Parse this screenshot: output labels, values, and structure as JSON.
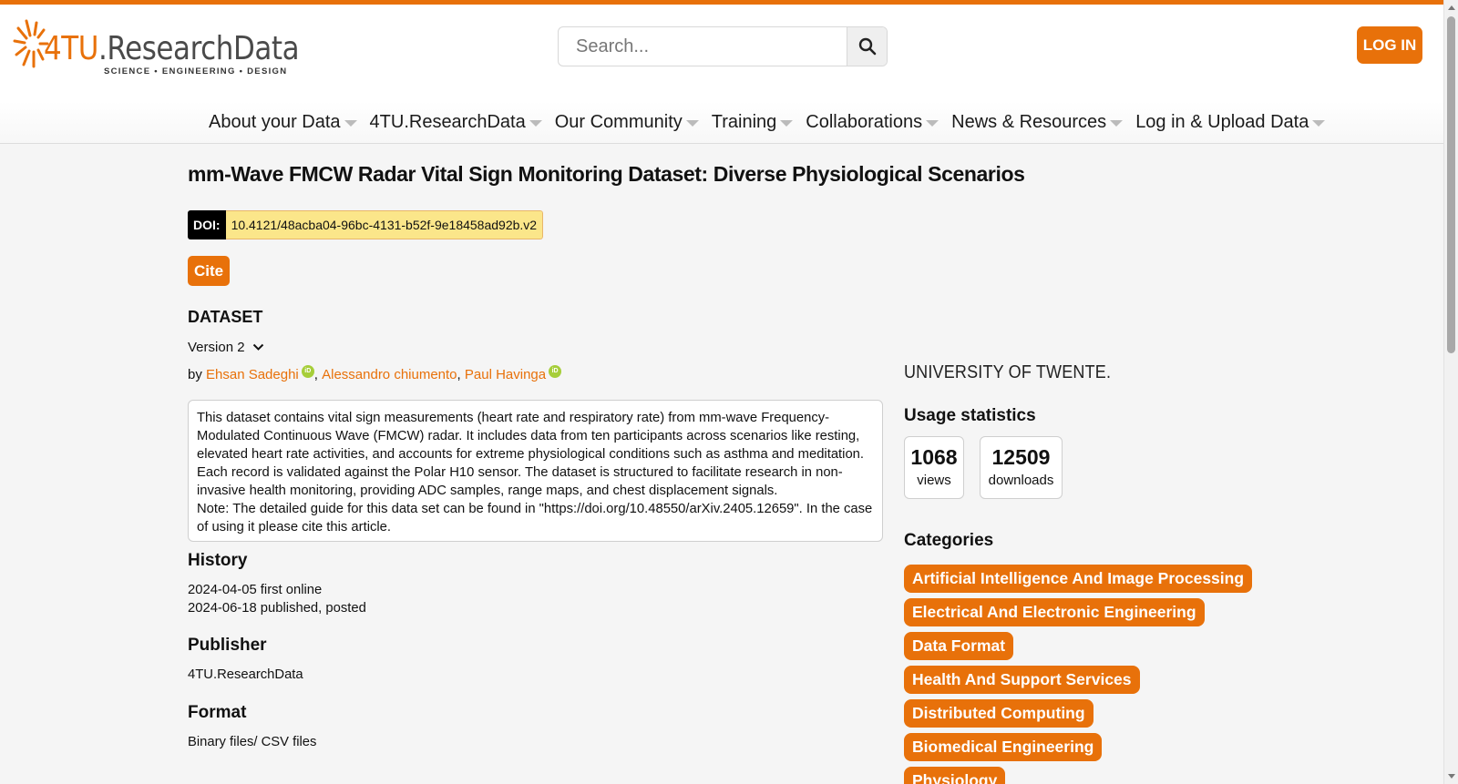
{
  "header": {
    "logo": {
      "brand": "4TU",
      "brand_rest": ".ResearchData",
      "tagline": "SCIENCE • ENGINEERING • DESIGN"
    },
    "search": {
      "placeholder": "Search...",
      "icon": "search-icon"
    },
    "login_label": "LOG IN"
  },
  "nav": {
    "items": [
      {
        "label": "About your Data"
      },
      {
        "label": "4TU.ResearchData"
      },
      {
        "label": "Our Community"
      },
      {
        "label": "Training"
      },
      {
        "label": "Collaborations"
      },
      {
        "label": "News & Resources"
      },
      {
        "label": "Log in & Upload Data"
      }
    ]
  },
  "dataset": {
    "title": "mm-Wave FMCW Radar Vital Sign Monitoring Dataset: Diverse Physiological Scenarios",
    "doi_label": "DOI:",
    "doi": "10.4121/48acba04-96bc-4131-b52f-9e18458ad92b.v2",
    "cite_label": "Cite",
    "section": "DATASET",
    "version": "Version 2",
    "by": "by",
    "authors": [
      {
        "name": "Ehsan Sadeghi",
        "orcid": true
      },
      {
        "name": "Alessandro chiumento",
        "orcid": false
      },
      {
        "name": "Paul Havinga",
        "orcid": true
      }
    ],
    "description": "This dataset contains vital sign measurements (heart rate and respiratory rate) from mm-wave Frequency-Modulated Continuous Wave (FMCW) radar. It includes data from ten participants across scenarios like resting, elevated heart rate activities, and accounts for extreme physiological conditions such as asthma and meditation. Each record is validated against the Polar H10 sensor. The dataset is structured to facilitate research in non-invasive health monitoring, providing ADC samples, range maps, and chest displacement signals.",
    "note": "Note: The detailed guide for this data set can be found in \"https://doi.org/10.48550/arXiv.2405.12659\". In the case of using it please cite this article.",
    "history_title": "History",
    "history": [
      "2024-04-05 first online",
      "2024-06-18 published, posted"
    ],
    "publisher_title": "Publisher",
    "publisher": "4TU.ResearchData",
    "format_title": "Format",
    "format": "Binary files/ CSV files"
  },
  "sidebar": {
    "institution": "UNIVERSITY OF TWENTE.",
    "usage_title": "Usage statistics",
    "views": {
      "value": "1068",
      "label": "views"
    },
    "downloads": {
      "value": "12509",
      "label": "downloads"
    },
    "categories_title": "Categories",
    "categories": [
      "Artificial Intelligence And Image Processing",
      "Electrical And Electronic Engineering",
      "Data Format",
      "Health And Support Services",
      "Distributed Computing",
      "Biomedical Engineering",
      "Physiology"
    ]
  },
  "colors": {
    "accent": "#e8710a",
    "doi_bg": "#fbe68a",
    "orcid": "#a6ce39"
  }
}
